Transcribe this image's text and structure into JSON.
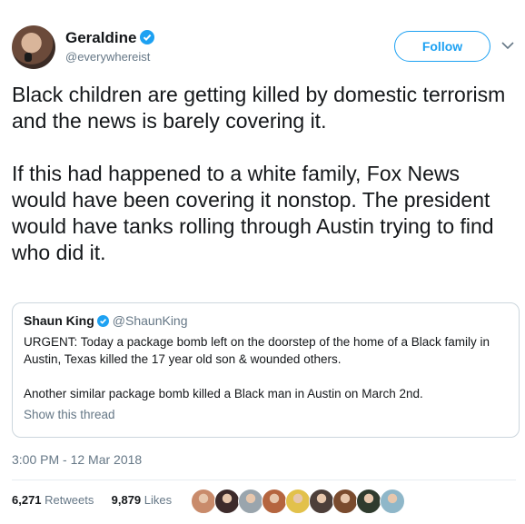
{
  "author": {
    "name": "Geraldine",
    "handle": "@everywhereist",
    "verified": true
  },
  "follow_label": "Follow",
  "tweet": {
    "paragraphs": [
      "Black children are getting killed by domestic terrorism and the news is barely covering it.",
      "If this had happened to a white family, Fox News would have been covering it nonstop. The president would have tanks rolling through Austin trying to find who did it."
    ]
  },
  "quote": {
    "name": "Shaun King",
    "handle": "@ShaunKing",
    "paragraphs": [
      "URGENT: Today a package bomb left on the doorstep of the home of a Black family in Austin, Texas killed the 17 year old son & wounded others.",
      "Another similar package bomb killed a Black man in Austin on March 2nd."
    ],
    "show_thread": "Show this thread"
  },
  "timestamp": "3:00 PM - 12 Mar 2018",
  "stats": {
    "retweets_count": "6,271",
    "retweets_label": "Retweets",
    "likes_count": "9,879",
    "likes_label": "Likes"
  },
  "liker_colors": [
    "#c98b6b",
    "#3d2b2b",
    "#9aa5ad",
    "#b5653f",
    "#e2c14b",
    "#4d3f3a",
    "#7a4b2e",
    "#2f3b2e",
    "#8fb7c9"
  ],
  "colors": {
    "accent": "#1da1f2",
    "text": "#14171a",
    "secondary": "#657786",
    "border": "#ccd6dd"
  }
}
